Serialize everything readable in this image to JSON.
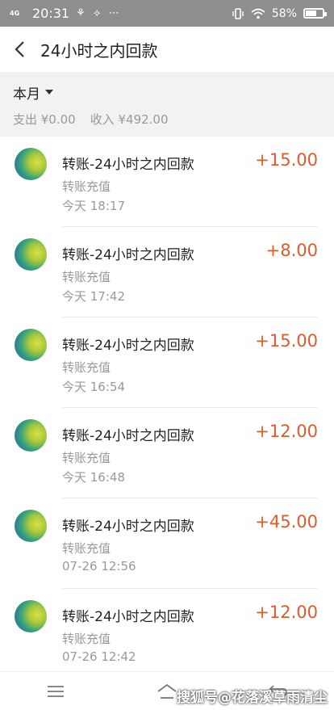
{
  "status_bar": {
    "network": "4G",
    "time": "20:31",
    "notification_icons": "⚘ ⟡ ⋯",
    "battery_percent": "58%"
  },
  "header": {
    "title": "24小时之内回款"
  },
  "summary": {
    "month": "本月",
    "expense": "支出 ¥0.00",
    "income": "收入 ¥492.00"
  },
  "transactions": [
    {
      "title": "转账-24小时之内回款",
      "type": "转账充值",
      "time": "今天  18:17",
      "amount": "+15.00"
    },
    {
      "title": "转账-24小时之内回款",
      "type": "转账充值",
      "time": "今天  17:42",
      "amount": "+8.00"
    },
    {
      "title": "转账-24小时之内回款",
      "type": "转账充值",
      "time": "今天  16:54",
      "amount": "+15.00"
    },
    {
      "title": "转账-24小时之内回款",
      "type": "转账充值",
      "time": "今天  16:48",
      "amount": "+12.00"
    },
    {
      "title": "转账-24小时之内回款",
      "type": "转账充值",
      "time": "07-26  12:56",
      "amount": "+45.00"
    },
    {
      "title": "转账-24小时之内回款",
      "type": "转账充值",
      "time": "07-26  12:42",
      "amount": "+12.00"
    }
  ],
  "watermark": "搜狐号@花落溪草雨清尘",
  "colors": {
    "amount": "#e05a2b",
    "status_bar": "#8e8e8e"
  }
}
